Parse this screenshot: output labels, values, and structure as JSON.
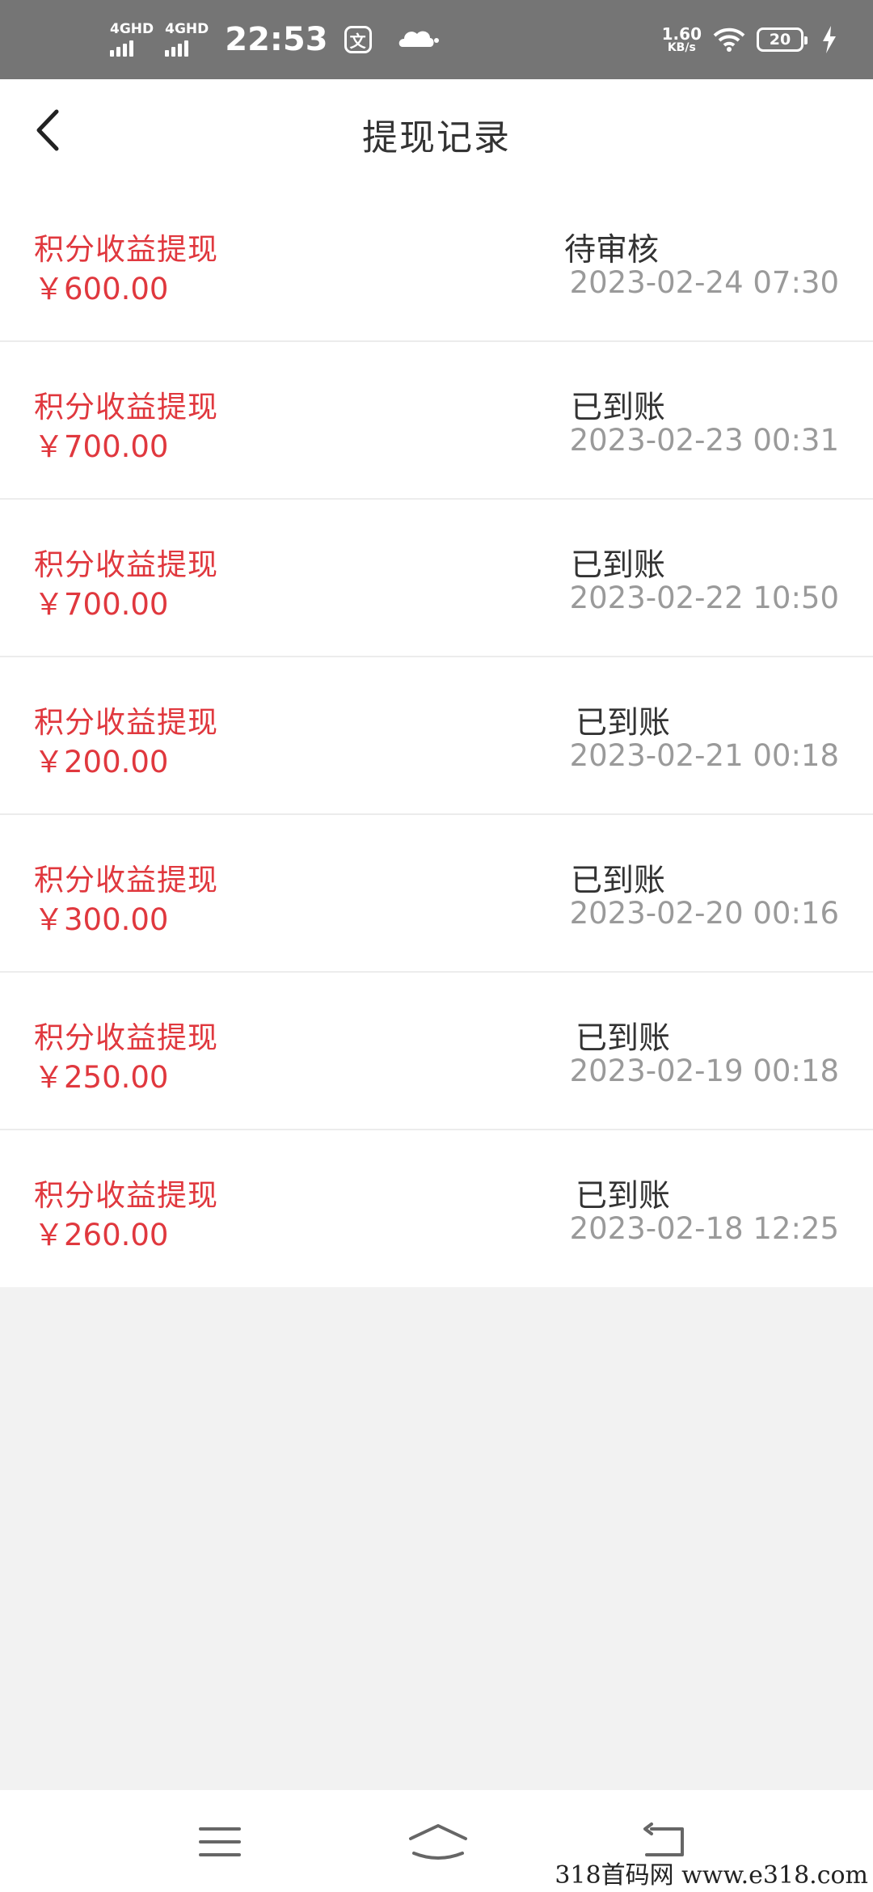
{
  "status_bar": {
    "signal1": "4GHD",
    "signal2": "4GHD",
    "time": "22:53",
    "app_icon_text": "文",
    "net_speed_value": "1.60",
    "net_speed_unit": "KB/s",
    "battery": "20",
    "icons": [
      "signal-icon",
      "cloud-icon",
      "wifi-icon",
      "battery-icon",
      "charging-icon"
    ]
  },
  "header": {
    "title": "提现记录",
    "back_icon": "chevron-left-icon"
  },
  "records": [
    {
      "type": "积分收益提现",
      "amount": "￥600.00",
      "status": "待审核",
      "time": "2023-02-24 07:30"
    },
    {
      "type": "积分收益提现",
      "amount": "￥700.00",
      "status": "已到账",
      "time": "2023-02-23 00:31"
    },
    {
      "type": "积分收益提现",
      "amount": "￥700.00",
      "status": "已到账",
      "time": "2023-02-22 10:50"
    },
    {
      "type": "积分收益提现",
      "amount": "￥200.00",
      "status": "已到账",
      "time": "2023-02-21 00:18"
    },
    {
      "type": "积分收益提现",
      "amount": "￥300.00",
      "status": "已到账",
      "time": "2023-02-20 00:16"
    },
    {
      "type": "积分收益提现",
      "amount": "￥250.00",
      "status": "已到账",
      "time": "2023-02-19 00:18"
    },
    {
      "type": "积分收益提现",
      "amount": "￥260.00",
      "status": "已到账",
      "time": "2023-02-18 12:25"
    }
  ],
  "bottom_nav": {
    "icons": [
      "menu-icon",
      "home-icon",
      "back-icon"
    ]
  },
  "watermark": "318首码网  www.e318.com",
  "colors": {
    "accent": "#e0383e",
    "status_bar": "#757575",
    "background": "#f2f2f2",
    "muted_text": "#9a9a9a"
  }
}
